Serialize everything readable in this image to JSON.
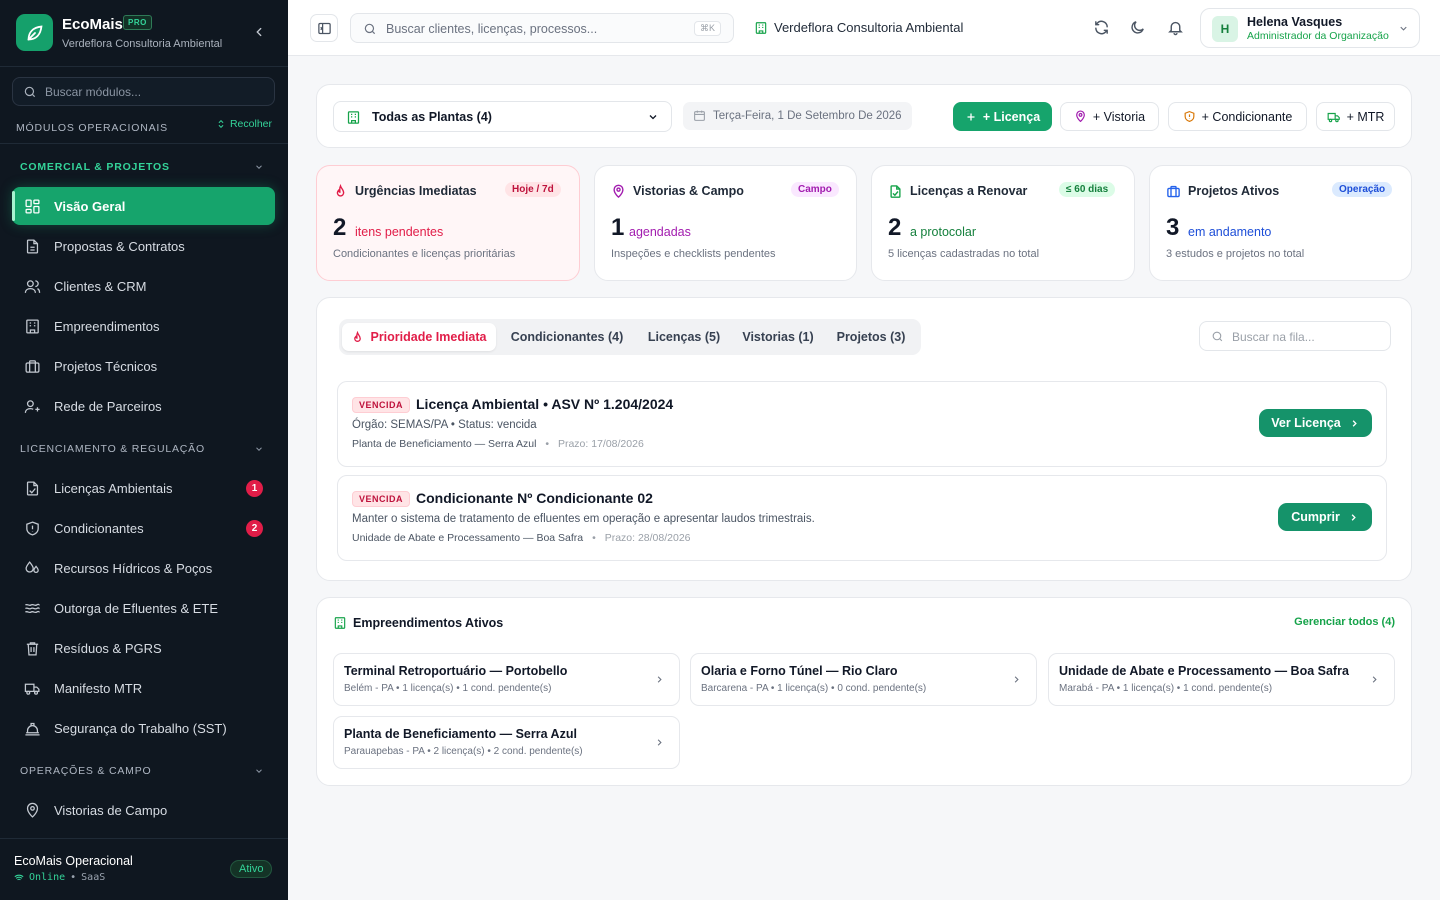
{
  "app": {
    "name": "EcoMais",
    "plan_badge": "PRO",
    "org": "Verdeflora Consultoria Ambiental"
  },
  "sidebar": {
    "search_placeholder": "Buscar módulos...",
    "modules_title": "MÓDULOS OPERACIONAIS",
    "collapse_label": "Recolher",
    "sections": [
      {
        "title": "COMERCIAL & PROJETOS",
        "items": [
          {
            "label": "Visão Geral",
            "icon": "dashboard-grid-icon",
            "active": true
          },
          {
            "label": "Propostas & Contratos",
            "icon": "document-icon"
          },
          {
            "label": "Clientes & CRM",
            "icon": "users-icon"
          },
          {
            "label": "Empreendimentos",
            "icon": "building-icon"
          },
          {
            "label": "Projetos Técnicos",
            "icon": "briefcase-icon"
          },
          {
            "label": "Rede de Parceiros",
            "icon": "user-network-icon"
          }
        ]
      },
      {
        "title": "LICENCIAMENTO & REGULAÇÃO",
        "items": [
          {
            "label": "Licenças Ambientais",
            "icon": "license-document-icon",
            "badge": "1"
          },
          {
            "label": "Condicionantes",
            "icon": "shield-icon",
            "badge": "2"
          },
          {
            "label": "Recursos Hídricos & Poços",
            "icon": "water-drop-icon"
          },
          {
            "label": "Outorga de Efluentes & ETE",
            "icon": "waves-icon"
          },
          {
            "label": "Resíduos & PGRS",
            "icon": "trash-icon"
          },
          {
            "label": "Manifesto MTR",
            "icon": "truck-icon"
          },
          {
            "label": "Segurança do Trabalho (SST)",
            "icon": "helmet-icon"
          }
        ]
      },
      {
        "title": "OPERAÇÕES & CAMPO",
        "items": [
          {
            "label": "Vistorias de Campo",
            "icon": "map-pin-icon"
          }
        ]
      }
    ],
    "footer": {
      "title": "EcoMais Operacional",
      "status": "Online",
      "mode": "SaaS",
      "badge": "Ativo"
    }
  },
  "topbar": {
    "search_placeholder": "Buscar clientes, licenças, processos...",
    "shortcut": "⌘K",
    "org": "Verdeflora Consultoria Ambiental",
    "user": {
      "initial": "H",
      "name": "Helena Vasques",
      "role": "Administrador da Organização"
    }
  },
  "filters": {
    "plant_select": "Todas as Plantas (4)",
    "date": "Terça-Feira, 1 De Setembro De 2026",
    "actions": [
      "+ Licença",
      "+ Vistoria",
      "+ Condicionante",
      "+ MTR"
    ]
  },
  "stats": [
    {
      "title": "Urgências Imediatas",
      "pill": "Hoje / 7d",
      "number": "2",
      "unit": "itens pendentes",
      "sub": "Condicionantes e licenças prioritárias"
    },
    {
      "title": "Vistorias & Campo",
      "pill": "Campo",
      "number": "1",
      "unit": "agendadas",
      "sub": "Inspeções e checklists pendentes"
    },
    {
      "title": "Licenças a Renovar",
      "pill": "≤ 60 dias",
      "number": "2",
      "unit": "a protocolar",
      "sub": "5 licenças cadastradas no total"
    },
    {
      "title": "Projetos Ativos",
      "pill": "Operação",
      "number": "3",
      "unit": "em andamento",
      "sub": "3 estudos e projetos no total"
    }
  ],
  "queue": {
    "tabs": [
      "Prioridade Imediata",
      "Condicionantes (4)",
      "Licenças (5)",
      "Vistorias (1)",
      "Projetos (3)"
    ],
    "search_placeholder": "Buscar na fila...",
    "items": [
      {
        "tag": "VENCIDA",
        "title": "Licença Ambiental • ASV Nº 1.204/2024",
        "desc": "Órgão: SEMAS/PA • Status: vencida",
        "place": "Planta de Beneficiamento — Serra Azul",
        "sep": "•",
        "deadline": "Prazo: 17/08/2026",
        "action": "Ver Licença"
      },
      {
        "tag": "VENCIDA",
        "title": "Condicionante Nº Condicionante 02",
        "desc": "Manter o sistema de tratamento de efluentes em operação e apresentar laudos trimestrais.",
        "place": "Unidade de Abate e Processamento — Boa Safra",
        "sep": "•",
        "deadline": "Prazo: 28/08/2026",
        "action": "Cumprir"
      }
    ]
  },
  "empreendimentos": {
    "title": "Empreendimentos Ativos",
    "manage_link": "Gerenciar todos (4)",
    "items": [
      {
        "name": "Terminal Retroportuário — Portobello",
        "info": "Belém - PA • 1 licença(s) • 1 cond. pendente(s)"
      },
      {
        "name": "Olaria e Forno Túnel — Rio Claro",
        "info": "Barcarena - PA • 1 licença(s) • 0 cond. pendente(s)"
      },
      {
        "name": "Unidade de Abate e Processamento — Boa Safra",
        "info": "Marabá - PA • 1 licença(s) • 1 cond. pendente(s)"
      },
      {
        "name": "Planta de Beneficiamento — Serra Azul",
        "info": "Parauapebas - PA • 2 licença(s) • 2 cond. pendente(s)"
      }
    ]
  },
  "colors": {
    "brand": "#16a46c",
    "sidebar_bg": "#0f1720",
    "danger": "#e11d48",
    "accent_blue": "#2563eb"
  }
}
